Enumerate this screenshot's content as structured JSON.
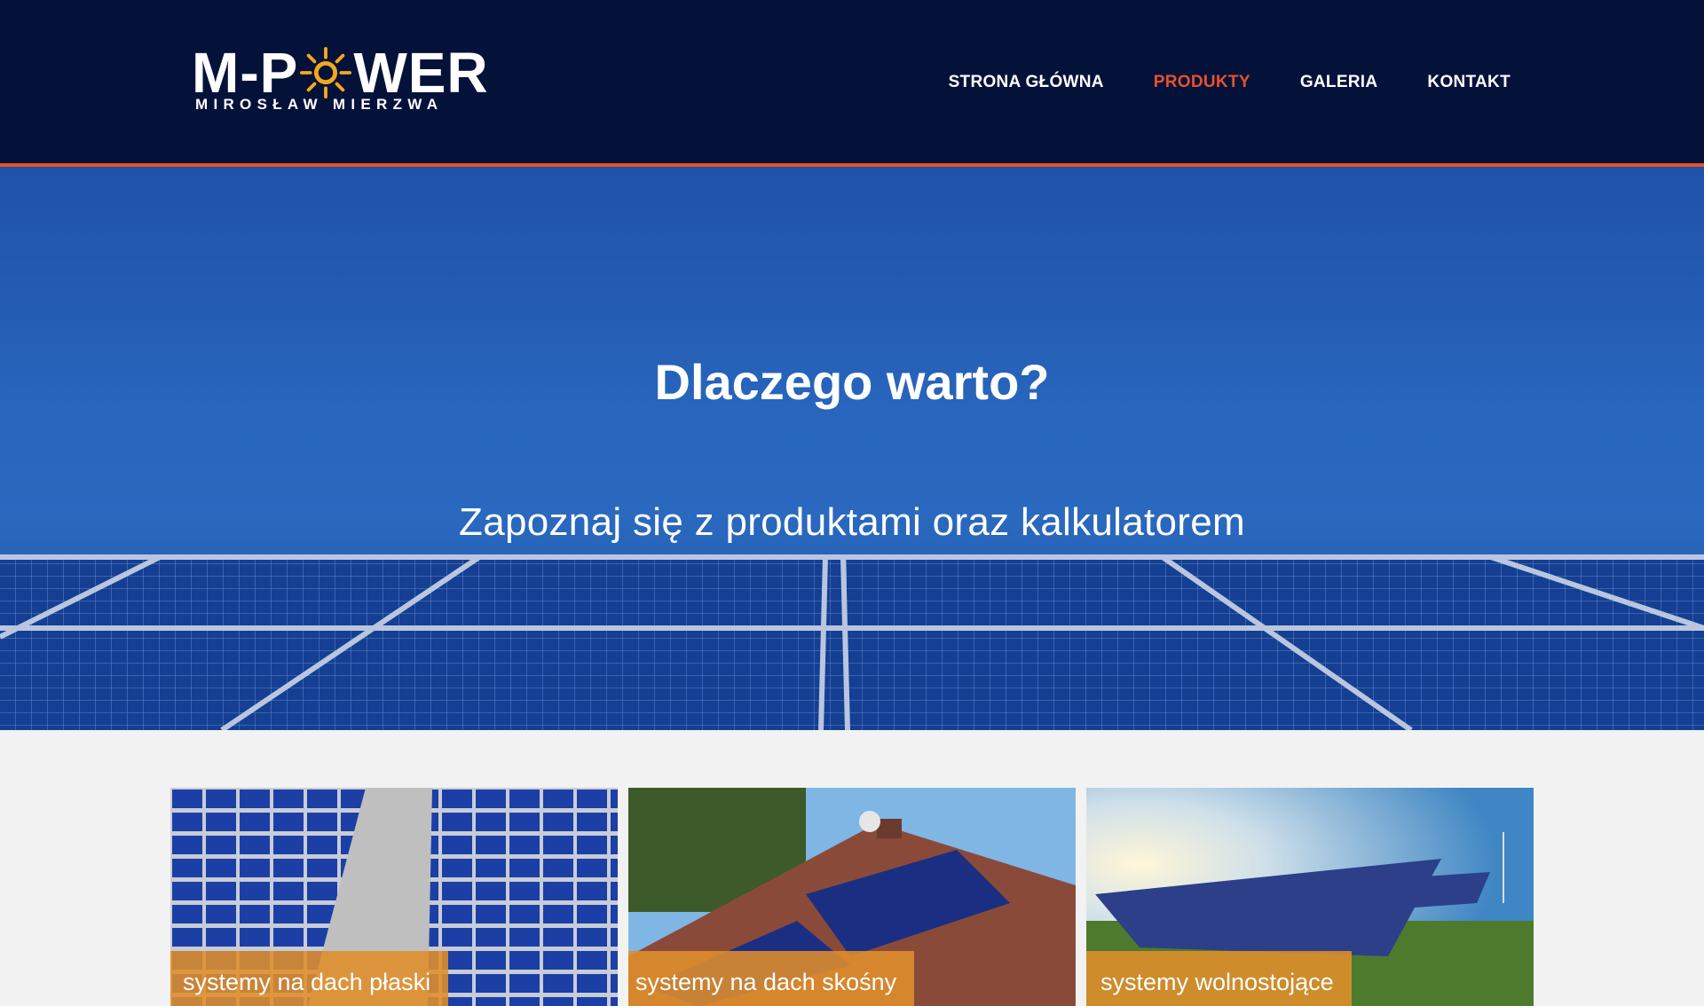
{
  "logo": {
    "brand": "M-POWER",
    "subtitle": "MIROSŁAW MIERZWA"
  },
  "nav": {
    "items": [
      {
        "label": "STRONA GŁÓWNA",
        "active": false
      },
      {
        "label": "PRODUKTY",
        "active": true
      },
      {
        "label": "GALERIA",
        "active": false
      },
      {
        "label": "KONTAKT",
        "active": false
      }
    ]
  },
  "hero": {
    "title": "Dlaczego warto?",
    "subtitle": "Zapoznaj się z produktami oraz kalkulatorem"
  },
  "cards": [
    {
      "label": "systemy na dach płaski",
      "image": "flat-roof-solar-photo"
    },
    {
      "label": "systemy na dach skośny",
      "image": "pitched-roof-solar-photo"
    },
    {
      "label": "systemy wolnostojące",
      "image": "ground-mounted-solar-photo"
    }
  ],
  "colors": {
    "header_bg": "#04123a",
    "accent": "#e8512a",
    "label_bg": "#e08e2a",
    "page_bg": "#f2f2f2"
  }
}
